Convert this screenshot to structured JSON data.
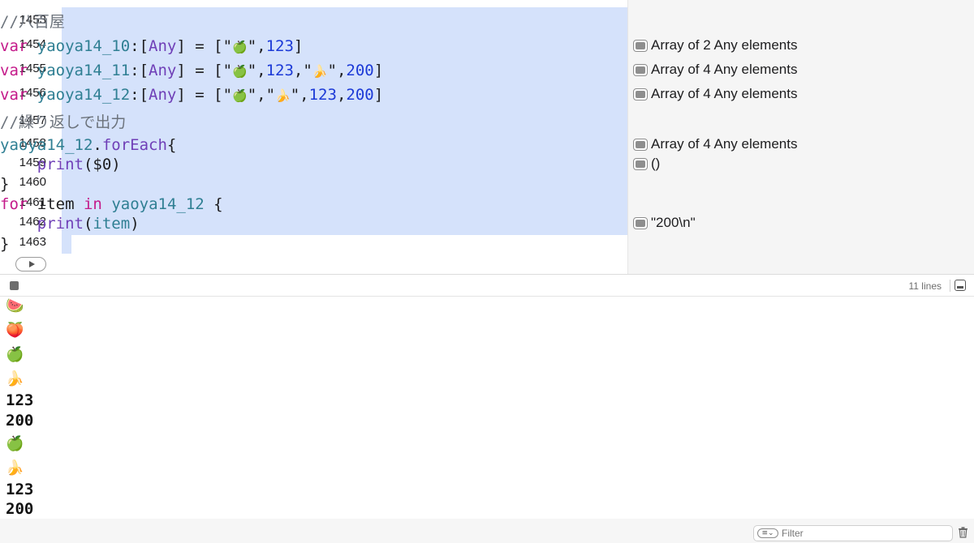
{
  "editor": {
    "lines": [
      {
        "num": "1453",
        "tokens": [
          {
            "t": "//八百屋",
            "c": "cm"
          }
        ]
      },
      {
        "num": "1454",
        "tokens": [
          {
            "t": "var ",
            "c": "kw"
          },
          {
            "t": "yaoya14_10",
            "c": "vr"
          },
          {
            "t": ":[",
            "c": "pl"
          },
          {
            "t": "Any",
            "c": "ty"
          },
          {
            "t": "] = [\"",
            "c": "pl"
          },
          {
            "t": "🍏",
            "c": "emoji"
          },
          {
            "t": "\",",
            "c": "pl"
          },
          {
            "t": "123",
            "c": "num"
          },
          {
            "t": "]",
            "c": "pl"
          }
        ]
      },
      {
        "num": "1455",
        "tokens": [
          {
            "t": "var ",
            "c": "kw"
          },
          {
            "t": "yaoya14_11",
            "c": "vr"
          },
          {
            "t": ":[",
            "c": "pl"
          },
          {
            "t": "Any",
            "c": "ty"
          },
          {
            "t": "] = [\"",
            "c": "pl"
          },
          {
            "t": "🍏",
            "c": "emoji"
          },
          {
            "t": "\",",
            "c": "pl"
          },
          {
            "t": "123",
            "c": "num"
          },
          {
            "t": ",\"",
            "c": "pl"
          },
          {
            "t": "🍌",
            "c": "emoji"
          },
          {
            "t": "\",",
            "c": "pl"
          },
          {
            "t": "200",
            "c": "num"
          },
          {
            "t": "]",
            "c": "pl"
          }
        ]
      },
      {
        "num": "1456",
        "tokens": [
          {
            "t": "var ",
            "c": "kw"
          },
          {
            "t": "yaoya14_12",
            "c": "vr"
          },
          {
            "t": ":[",
            "c": "pl"
          },
          {
            "t": "Any",
            "c": "ty"
          },
          {
            "t": "] = [\"",
            "c": "pl"
          },
          {
            "t": "🍏",
            "c": "emoji"
          },
          {
            "t": "\",\"",
            "c": "pl"
          },
          {
            "t": "🍌",
            "c": "emoji"
          },
          {
            "t": "\",",
            "c": "pl"
          },
          {
            "t": "123",
            "c": "num"
          },
          {
            "t": ",",
            "c": "pl"
          },
          {
            "t": "200",
            "c": "num"
          },
          {
            "t": "]",
            "c": "pl"
          }
        ]
      },
      {
        "num": "1457",
        "tokens": [
          {
            "t": "//繰り返しで出力",
            "c": "cm"
          }
        ]
      },
      {
        "num": "1458",
        "tokens": [
          {
            "t": "yaoya14_12",
            "c": "vr"
          },
          {
            "t": ".",
            "c": "pl"
          },
          {
            "t": "forEach",
            "c": "fn"
          },
          {
            "t": "{",
            "c": "pl"
          }
        ]
      },
      {
        "num": "1459",
        "tokens": [
          {
            "t": "    ",
            "c": "pl"
          },
          {
            "t": "print",
            "c": "fn"
          },
          {
            "t": "($0)",
            "c": "pl"
          }
        ]
      },
      {
        "num": "1460",
        "tokens": [
          {
            "t": "}",
            "c": "pl"
          }
        ]
      },
      {
        "num": "1461",
        "tokens": [
          {
            "t": "for",
            "c": "kw"
          },
          {
            "t": " item ",
            "c": "pl"
          },
          {
            "t": "in",
            "c": "kw"
          },
          {
            "t": " ",
            "c": "pl"
          },
          {
            "t": "yaoya14_12",
            "c": "vr"
          },
          {
            "t": " {",
            "c": "pl"
          }
        ]
      },
      {
        "num": "1462",
        "tokens": [
          {
            "t": "    ",
            "c": "pl"
          },
          {
            "t": "print",
            "c": "fn"
          },
          {
            "t": "(",
            "c": "pl"
          },
          {
            "t": "item",
            "c": "vr"
          },
          {
            "t": ")",
            "c": "pl"
          }
        ]
      },
      {
        "num": "1463",
        "tokens": [
          {
            "t": "}",
            "c": "pl"
          }
        ]
      }
    ],
    "run_icon": "play-icon"
  },
  "results": [
    {
      "line": "1454",
      "text": "Array of 2 Any elements"
    },
    {
      "line": "1455",
      "text": "Array of 4 Any elements"
    },
    {
      "line": "1456",
      "text": "Array of 4 Any elements"
    },
    {
      "line": "1458",
      "text": "Array of 4 Any elements"
    },
    {
      "line": "1459",
      "text": "()"
    },
    {
      "line": "1462",
      "text": "\"200\\n\""
    }
  ],
  "console": {
    "line_count": "11 lines",
    "output": [
      "🍉",
      "🍑",
      "🍏",
      "🍌",
      "123",
      "200",
      "🍏",
      "🍌",
      "123",
      "200"
    ]
  },
  "footer": {
    "filter_placeholder": "Filter"
  },
  "colors": {
    "selection": "#d5e2fb",
    "keyword": "#c41a8a",
    "variable": "#2f7f93",
    "type": "#6f3fb7",
    "number": "#1c3ad7",
    "comment": "#6c737c"
  }
}
